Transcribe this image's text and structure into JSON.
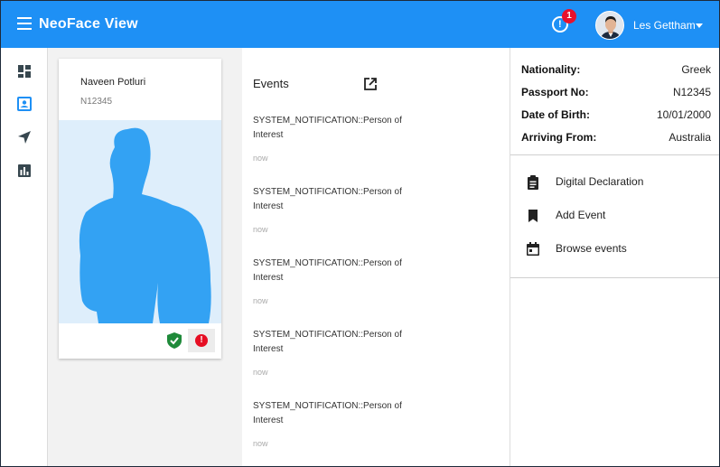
{
  "app": {
    "title": "NeoFace View",
    "notification_count": "1",
    "user_name": "Les Gettham",
    "primary_color": "#1e90f5"
  },
  "rail": {
    "items": [
      {
        "icon": "dashboard-icon"
      },
      {
        "icon": "person-badge-icon",
        "active": true
      },
      {
        "icon": "navigation-icon"
      },
      {
        "icon": "bar-chart-icon"
      }
    ]
  },
  "person": {
    "name": "Naveen Potluri",
    "id": "N12345",
    "status_icons": [
      "shield-check-icon",
      "alert-icon"
    ]
  },
  "events": {
    "title": "Events",
    "items": [
      {
        "text": "SYSTEM_NOTIFICATION::Person of Interest",
        "time": "now"
      },
      {
        "text": "SYSTEM_NOTIFICATION::Person of Interest",
        "time": "now"
      },
      {
        "text": "SYSTEM_NOTIFICATION::Person of Interest",
        "time": "now"
      },
      {
        "text": "SYSTEM_NOTIFICATION::Person of Interest",
        "time": "now"
      },
      {
        "text": "SYSTEM_NOTIFICATION::Person of Interest",
        "time": "now"
      }
    ]
  },
  "details": {
    "nationality_label": "Nationality:",
    "nationality": "Greek",
    "passport_label": "Passport No:",
    "passport": "N12345",
    "dob_label": "Date of Birth:",
    "dob": "10/01/2000",
    "arriving_label": "Arriving From:",
    "arriving": "Australia"
  },
  "actions": {
    "declaration": "Digital Declaration",
    "add_event": "Add Event",
    "browse_events": "Browse events"
  }
}
